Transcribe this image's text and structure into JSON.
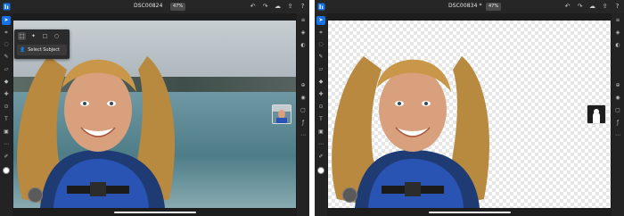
{
  "colors": {
    "accent": "#1473e6",
    "chrome": "#1d1d1d",
    "toolbar": "#262626",
    "text": "#e8e8e8"
  },
  "screens": [
    {
      "app_icon": "photoshop-home-icon",
      "title": "DSC00824",
      "zoom": "47%",
      "top_actions": [
        "undo-icon",
        "redo-icon",
        "cloud-icon",
        "share-icon",
        "help-icon"
      ],
      "left_tools": [
        "select-tool-icon",
        "crop-transform-icon",
        "lasso-icon",
        "brush-icon",
        "eraser-icon",
        "fill-icon",
        "healing-icon",
        "clone-icon",
        "type-icon",
        "place-image-icon",
        "more-icon",
        "eyedropper-icon",
        "color-well-icon"
      ],
      "right_tools": [
        "layers-icon",
        "layer-properties-icon",
        "adjustments-icon",
        "add-layer-icon",
        "visibility-icon",
        "mask-icon",
        "fx-icon",
        "more-icon"
      ],
      "popover": {
        "tools": [
          "rect-select-icon",
          "magic-wand-icon",
          "rect-marquee-icon",
          "ellipse-marquee-icon"
        ],
        "action_label": "Select Subject",
        "action_icon": "select-subject-icon"
      },
      "background": "scene",
      "layer_thumb": "photo"
    },
    {
      "app_icon": "photoshop-home-icon",
      "title": "DSC00834 *",
      "zoom": "47%",
      "top_actions": [
        "undo-icon",
        "redo-icon",
        "cloud-icon",
        "share-icon",
        "help-icon"
      ],
      "left_tools": [
        "select-tool-icon",
        "crop-transform-icon",
        "lasso-icon",
        "brush-icon",
        "eraser-icon",
        "fill-icon",
        "healing-icon",
        "clone-icon",
        "type-icon",
        "place-image-icon",
        "more-icon",
        "eyedropper-icon",
        "color-well-icon"
      ],
      "right_tools": [
        "layers-icon",
        "layer-properties-icon",
        "adjustments-icon",
        "add-layer-icon",
        "visibility-icon",
        "mask-icon",
        "fx-icon",
        "more-icon"
      ],
      "background": "transparent",
      "layer_thumb": "mask"
    }
  ]
}
